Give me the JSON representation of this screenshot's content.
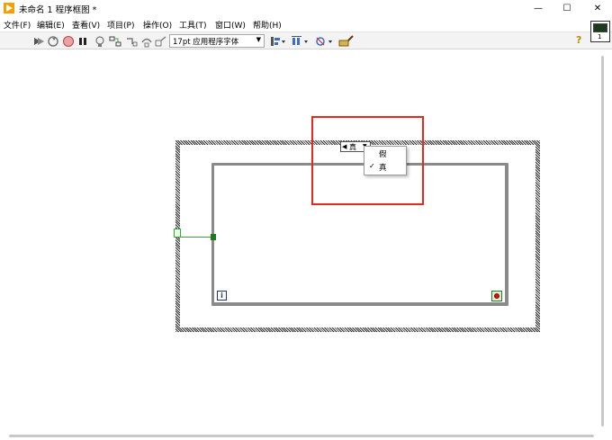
{
  "window": {
    "title": "未命名 1 程序框图 *",
    "minimize": "—",
    "maximize": "☐",
    "close": "✕"
  },
  "menu": {
    "items": [
      {
        "label": "文件(F)"
      },
      {
        "label": "编辑(E)"
      },
      {
        "label": "查看(V)"
      },
      {
        "label": "项目(P)"
      },
      {
        "label": "操作(O)"
      },
      {
        "label": "工具(T)"
      },
      {
        "label": "窗口(W)"
      },
      {
        "label": "帮助(H)"
      }
    ]
  },
  "toolbar": {
    "font_select": "17pt 应用程序字体",
    "help": "?",
    "vi_icon_number": "1"
  },
  "diagram": {
    "case_label": "真",
    "iteration_terminal": "i",
    "popup": {
      "items": [
        {
          "label": "假",
          "checked": false
        },
        {
          "label": "真",
          "checked": true
        }
      ],
      "check_mark": "✓"
    }
  },
  "colors": {
    "annotation": "#e8281a",
    "loop_border": "#8a8a8a",
    "wire": "#3aa33a",
    "iteration": "#1c2fa0"
  }
}
